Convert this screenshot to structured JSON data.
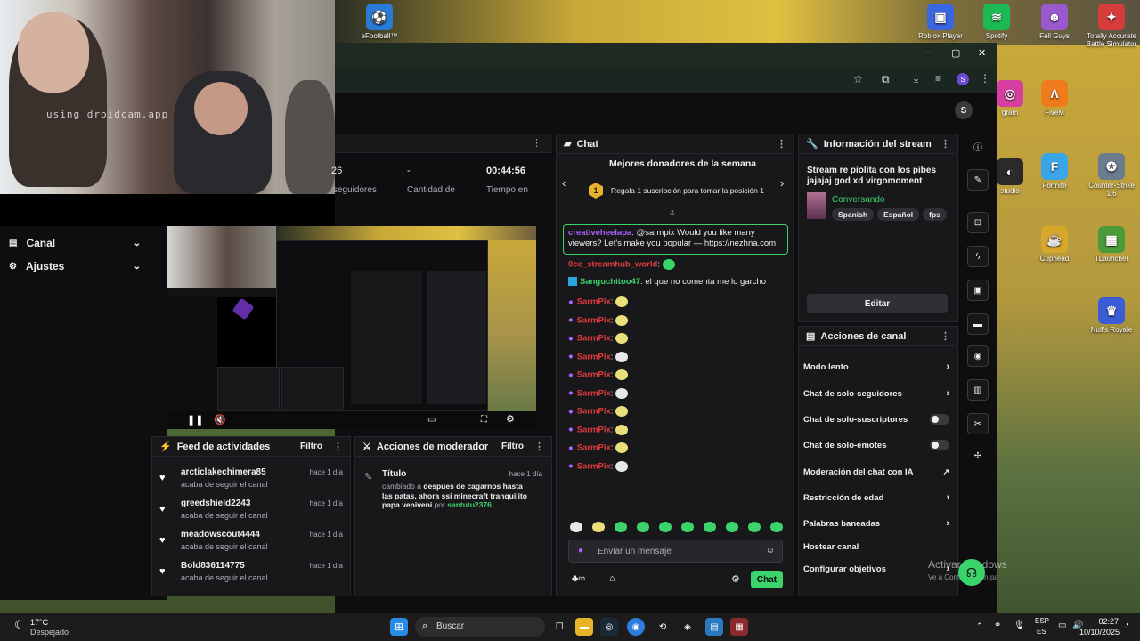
{
  "desktop": {
    "icons": [
      {
        "label": "eFootball™",
        "color": "#2a7bd6",
        "glyph": "⚽"
      },
      {
        "label": "Roblox Player",
        "color": "#3a66e0",
        "glyph": "▣"
      },
      {
        "label": "Spotify",
        "color": "#1db954",
        "glyph": "≋"
      },
      {
        "label": "Fall Guys",
        "color": "#9b59d0",
        "glyph": "☻"
      },
      {
        "label": "Totally Accurate Battle Simulator",
        "color": "#d63c3c",
        "glyph": "✦"
      },
      {
        "label": "gram",
        "color": "#d63fa0",
        "glyph": "◎"
      },
      {
        "label": "FiveM",
        "color": "#f07b1c",
        "glyph": "Λ"
      },
      {
        "label": "studio",
        "color": "#2a2a2a",
        "glyph": "◐"
      },
      {
        "label": "Fortnite",
        "color": "#3aa6e8",
        "glyph": "F"
      },
      {
        "label": "Counter-Strike 1.6",
        "color": "#6b7c8f",
        "glyph": "✪"
      },
      {
        "label": "Cuphead",
        "color": "#d6a72a",
        "glyph": "☕"
      },
      {
        "label": "TLauncher",
        "color": "#4c9b3a",
        "glyph": "▦"
      },
      {
        "label": "Null's Royale",
        "color": "#3a5cd6",
        "glyph": "♛"
      }
    ]
  },
  "webcam": {
    "watermark": "using droidcam.app"
  },
  "browser": {
    "minimize": "—",
    "maximize": "▢",
    "close": "✕",
    "avatar_letter": "S",
    "user_avatar_letter": "S"
  },
  "stats": {
    "followers_value": "26",
    "followers_label": "seguidores",
    "amount_value": "-",
    "amount_label": "Cantidad de",
    "time_value": "00:44:56",
    "time_label": "Tiempo en"
  },
  "nav": {
    "canal": "Canal",
    "ajustes": "Ajustes"
  },
  "chat": {
    "header": "Chat",
    "donors_title": "Mejores donadores de la semana",
    "donors_badge": "1",
    "donors_text": "Regala 1 suscripción para tomar la posición 1",
    "highlight_user": "creativeheelapa",
    "highlight_text": ": @sarmpix Would you like many viewers? Let's make you popular — https://nezhna.com",
    "msg2_user": "0ce_streamhub_world",
    "msg3_user": "Sanguchitoo47",
    "msg3_text": ": el que no comenta me lo garcho",
    "repeat_user": "SarmPix",
    "repeat_count": 10,
    "input_placeholder": "Enviar un mensaje",
    "send_button": "Chat"
  },
  "stream_info": {
    "header": "Información del stream",
    "title": "Stream re piolita con los pibes jajajaj god xd virgomoment",
    "category": "Conversando",
    "tags": [
      "Spanish",
      "Español",
      "fps"
    ],
    "edit_button": "Editar"
  },
  "channel_actions": {
    "header": "Acciones de canal",
    "items": [
      {
        "label": "Modo lento",
        "kind": "arrow"
      },
      {
        "label": "Chat de solo-seguidores",
        "kind": "arrow"
      },
      {
        "label": "Chat de solo-suscriptores",
        "kind": "toggle"
      },
      {
        "label": "Chat de solo-emotes",
        "kind": "toggle"
      },
      {
        "label": "Moderación del chat con IA",
        "kind": "external"
      },
      {
        "label": "Restricción de edad",
        "kind": "arrow"
      },
      {
        "label": "Palabras baneadas",
        "kind": "arrow"
      },
      {
        "label": "Hostear canal",
        "kind": "none"
      },
      {
        "label": "Configurar objetivos",
        "kind": "arrow"
      }
    ]
  },
  "feed": {
    "header": "Feed de actividades",
    "filter": "Filtro",
    "items": [
      {
        "name": "arcticlakechimera85",
        "sub": "acaba de seguir el canal",
        "time": "hace 1 día"
      },
      {
        "name": "greedshield2243",
        "sub": "acaba de seguir el canal",
        "time": "hace 1 día"
      },
      {
        "name": "meadowscout4444",
        "sub": "acaba de seguir el canal",
        "time": "hace 1 día"
      },
      {
        "name": "Bold836114775",
        "sub": "acaba de seguir el canal",
        "time": "hace 1 día"
      }
    ]
  },
  "mod_actions": {
    "header": "Acciones de moderador",
    "filter": "Filtro",
    "entry_title": "Título",
    "entry_time": "hace 1 día",
    "entry_prefix": "cambiado a ",
    "entry_value": "despues de cagarnos hasta las patas, ahora ssi minecraft tranquilito papa veniveni",
    "entry_by": " por ",
    "entry_user": "santutu2376"
  },
  "watermark": {
    "line1": "Activar Windows",
    "line2": "Ve a Configuración para activar Windows."
  },
  "taskbar": {
    "weather_temp": "17°C",
    "weather_desc": "Despejado",
    "search": "Buscar",
    "lang1": "ESP",
    "lang2": "ES",
    "time": "02:27",
    "date": "10/10/2025"
  }
}
